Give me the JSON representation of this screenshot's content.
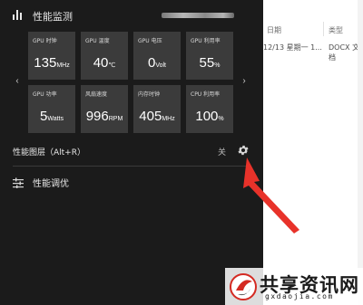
{
  "panel": {
    "title": "性能监测",
    "blurred_text": "",
    "metrics": [
      {
        "label": "GPU 时钟",
        "value": "135",
        "unit": "MHz"
      },
      {
        "label": "GPU 温度",
        "value": "40",
        "unit": "℃"
      },
      {
        "label": "GPU 电压",
        "value": "0",
        "unit": "Volt"
      },
      {
        "label": "GPU 利用率",
        "value": "55",
        "unit": "%"
      },
      {
        "label": "GPU 功率",
        "value": "5",
        "unit": "Watts"
      },
      {
        "label": "风扇速度",
        "value": "996",
        "unit": "RPM"
      },
      {
        "label": "内存时钟",
        "value": "405",
        "unit": "MHz"
      },
      {
        "label": "CPU 利用率",
        "value": "100",
        "unit": "%"
      }
    ],
    "prev_arrow": "‹",
    "next_arrow": "›",
    "overlay": {
      "label": "性能图层（Alt+R）",
      "state": "关"
    },
    "tuning": {
      "label": "性能调优"
    }
  },
  "explorer": {
    "col_date": "日期",
    "col_type": "类型",
    "row": {
      "date": "12/13 星期一 1...",
      "type": "DOCX 文档"
    }
  },
  "watermark": {
    "text": "共享资讯网",
    "sub": "gxdaojia.com"
  },
  "colors": {
    "panel_bg": "#1b1b1b",
    "tile_bg": "#3b3b3b",
    "annotation": "#e8322a"
  }
}
